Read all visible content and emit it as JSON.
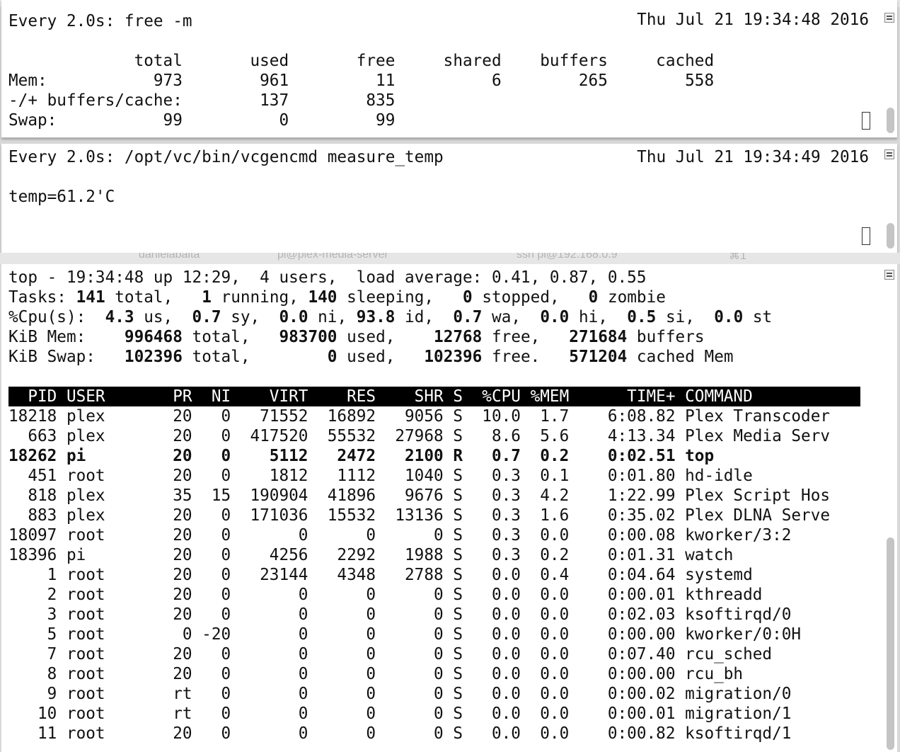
{
  "free_pane": {
    "command": "Every 2.0s: free -m",
    "timestamp": "Thu Jul 21 19:34:48 2016",
    "lines": [
      "",
      "             total       used       free     shared    buffers     cached",
      "Mem:           973        961         11          6        265        558",
      "-/+ buffers/cache:        137        835",
      "Swap:           99          0         99"
    ]
  },
  "temp_pane": {
    "command": "Every 2.0s: /opt/vc/bin/vcgencmd measure_temp",
    "timestamp": "Thu Jul 21 19:34:49 2016",
    "value": "temp=61.2'C"
  },
  "background_window": {
    "title_fragments": [
      "danielabalta",
      "pi@plex-media-server",
      "ssh pi@192.168.0.9",
      "⌘1"
    ]
  },
  "top_pane": {
    "summary": {
      "line1": "top - 19:34:48 up 12:29,  4 users,  load average: 0.41, 0.87, 0.55",
      "tasks": [
        {
          "t": "Tasks: ",
          "b": false
        },
        {
          "t": "141",
          "b": true
        },
        {
          "t": " total,   ",
          "b": false
        },
        {
          "t": "1",
          "b": true
        },
        {
          "t": " running, ",
          "b": false
        },
        {
          "t": "140",
          "b": true
        },
        {
          "t": " sleeping,   ",
          "b": false
        },
        {
          "t": "0",
          "b": true
        },
        {
          "t": " stopped,   ",
          "b": false
        },
        {
          "t": "0",
          "b": true
        },
        {
          "t": " zombie",
          "b": false
        }
      ],
      "cpu": [
        {
          "t": "%Cpu(s):  ",
          "b": false
        },
        {
          "t": "4.3",
          "b": true
        },
        {
          "t": " us,  ",
          "b": false
        },
        {
          "t": "0.7",
          "b": true
        },
        {
          "t": " sy,  ",
          "b": false
        },
        {
          "t": "0.0",
          "b": true
        },
        {
          "t": " ni, ",
          "b": false
        },
        {
          "t": "93.8",
          "b": true
        },
        {
          "t": " id,  ",
          "b": false
        },
        {
          "t": "0.7",
          "b": true
        },
        {
          "t": " wa,  ",
          "b": false
        },
        {
          "t": "0.0",
          "b": true
        },
        {
          "t": " hi,  ",
          "b": false
        },
        {
          "t": "0.5",
          "b": true
        },
        {
          "t": " si,  ",
          "b": false
        },
        {
          "t": "0.0",
          "b": true
        },
        {
          "t": " st",
          "b": false
        }
      ],
      "mem": [
        {
          "t": "KiB Mem:    ",
          "b": false
        },
        {
          "t": "996468",
          "b": true
        },
        {
          "t": " total,   ",
          "b": false
        },
        {
          "t": "983700",
          "b": true
        },
        {
          "t": " used,    ",
          "b": false
        },
        {
          "t": "12768",
          "b": true
        },
        {
          "t": " free,   ",
          "b": false
        },
        {
          "t": "271684",
          "b": true
        },
        {
          "t": " buffers",
          "b": false
        }
      ],
      "swap": [
        {
          "t": "KiB Swap:   ",
          "b": false
        },
        {
          "t": "102396",
          "b": true
        },
        {
          "t": " total,        ",
          "b": false
        },
        {
          "t": "0",
          "b": true
        },
        {
          "t": " used,   ",
          "b": false
        },
        {
          "t": "102396",
          "b": true
        },
        {
          "t": " free.   ",
          "b": false
        },
        {
          "t": "571204",
          "b": true
        },
        {
          "t": " cached Mem",
          "b": false
        }
      ]
    },
    "columns": [
      "PID",
      "USER",
      "PR",
      "NI",
      "VIRT",
      "RES",
      "SHR",
      "S",
      "%CPU",
      "%MEM",
      "TIME+",
      "COMMAND"
    ],
    "processes": [
      {
        "pid": "18218",
        "user": "plex",
        "pr": "20",
        "ni": "0",
        "virt": "71552",
        "res": "16892",
        "shr": "9056",
        "s": "S",
        "cpu": "10.0",
        "mem": "1.7",
        "time": "6:08.82",
        "cmd": "Plex Transcoder",
        "bold": false
      },
      {
        "pid": "663",
        "user": "plex",
        "pr": "20",
        "ni": "0",
        "virt": "417520",
        "res": "55532",
        "shr": "27968",
        "s": "S",
        "cpu": "8.6",
        "mem": "5.6",
        "time": "4:13.34",
        "cmd": "Plex Media Serv",
        "bold": false
      },
      {
        "pid": "18262",
        "user": "pi",
        "pr": "20",
        "ni": "0",
        "virt": "5112",
        "res": "2472",
        "shr": "2100",
        "s": "R",
        "cpu": "0.7",
        "mem": "0.2",
        "time": "0:02.51",
        "cmd": "top",
        "bold": true
      },
      {
        "pid": "451",
        "user": "root",
        "pr": "20",
        "ni": "0",
        "virt": "1812",
        "res": "1112",
        "shr": "1040",
        "s": "S",
        "cpu": "0.3",
        "mem": "0.1",
        "time": "0:01.80",
        "cmd": "hd-idle",
        "bold": false
      },
      {
        "pid": "818",
        "user": "plex",
        "pr": "35",
        "ni": "15",
        "virt": "190904",
        "res": "41896",
        "shr": "9676",
        "s": "S",
        "cpu": "0.3",
        "mem": "4.2",
        "time": "1:22.99",
        "cmd": "Plex Script Hos",
        "bold": false
      },
      {
        "pid": "883",
        "user": "plex",
        "pr": "20",
        "ni": "0",
        "virt": "171036",
        "res": "15532",
        "shr": "13136",
        "s": "S",
        "cpu": "0.3",
        "mem": "1.6",
        "time": "0:35.02",
        "cmd": "Plex DLNA Serve",
        "bold": false
      },
      {
        "pid": "18097",
        "user": "root",
        "pr": "20",
        "ni": "0",
        "virt": "0",
        "res": "0",
        "shr": "0",
        "s": "S",
        "cpu": "0.3",
        "mem": "0.0",
        "time": "0:00.08",
        "cmd": "kworker/3:2",
        "bold": false
      },
      {
        "pid": "18396",
        "user": "pi",
        "pr": "20",
        "ni": "0",
        "virt": "4256",
        "res": "2292",
        "shr": "1988",
        "s": "S",
        "cpu": "0.3",
        "mem": "0.2",
        "time": "0:01.31",
        "cmd": "watch",
        "bold": false
      },
      {
        "pid": "1",
        "user": "root",
        "pr": "20",
        "ni": "0",
        "virt": "23144",
        "res": "4348",
        "shr": "2788",
        "s": "S",
        "cpu": "0.0",
        "mem": "0.4",
        "time": "0:04.64",
        "cmd": "systemd",
        "bold": false
      },
      {
        "pid": "2",
        "user": "root",
        "pr": "20",
        "ni": "0",
        "virt": "0",
        "res": "0",
        "shr": "0",
        "s": "S",
        "cpu": "0.0",
        "mem": "0.0",
        "time": "0:00.01",
        "cmd": "kthreadd",
        "bold": false
      },
      {
        "pid": "3",
        "user": "root",
        "pr": "20",
        "ni": "0",
        "virt": "0",
        "res": "0",
        "shr": "0",
        "s": "S",
        "cpu": "0.0",
        "mem": "0.0",
        "time": "0:02.03",
        "cmd": "ksoftirqd/0",
        "bold": false
      },
      {
        "pid": "5",
        "user": "root",
        "pr": "0",
        "ni": "-20",
        "virt": "0",
        "res": "0",
        "shr": "0",
        "s": "S",
        "cpu": "0.0",
        "mem": "0.0",
        "time": "0:00.00",
        "cmd": "kworker/0:0H",
        "bold": false
      },
      {
        "pid": "7",
        "user": "root",
        "pr": "20",
        "ni": "0",
        "virt": "0",
        "res": "0",
        "shr": "0",
        "s": "S",
        "cpu": "0.0",
        "mem": "0.0",
        "time": "0:07.40",
        "cmd": "rcu_sched",
        "bold": false
      },
      {
        "pid": "8",
        "user": "root",
        "pr": "20",
        "ni": "0",
        "virt": "0",
        "res": "0",
        "shr": "0",
        "s": "S",
        "cpu": "0.0",
        "mem": "0.0",
        "time": "0:00.00",
        "cmd": "rcu_bh",
        "bold": false
      },
      {
        "pid": "9",
        "user": "root",
        "pr": "rt",
        "ni": "0",
        "virt": "0",
        "res": "0",
        "shr": "0",
        "s": "S",
        "cpu": "0.0",
        "mem": "0.0",
        "time": "0:00.02",
        "cmd": "migration/0",
        "bold": false
      },
      {
        "pid": "10",
        "user": "root",
        "pr": "rt",
        "ni": "0",
        "virt": "0",
        "res": "0",
        "shr": "0",
        "s": "S",
        "cpu": "0.0",
        "mem": "0.0",
        "time": "0:00.01",
        "cmd": "migration/1",
        "bold": false
      },
      {
        "pid": "11",
        "user": "root",
        "pr": "20",
        "ni": "0",
        "virt": "0",
        "res": "0",
        "shr": "0",
        "s": "S",
        "cpu": "0.0",
        "mem": "0.0",
        "time": "0:00.82",
        "cmd": "ksoftirqd/1",
        "bold": false
      }
    ]
  }
}
